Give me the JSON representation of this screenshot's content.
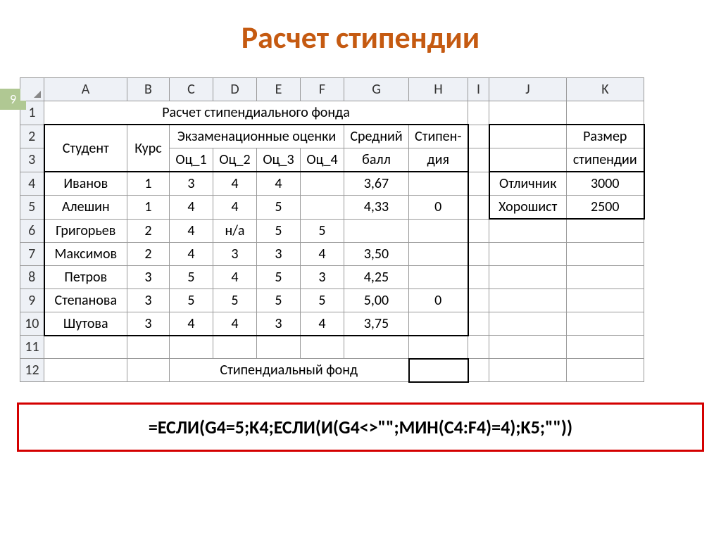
{
  "title": "Расчет стипендии",
  "page_num": "9",
  "cols": [
    "A",
    "B",
    "C",
    "D",
    "E",
    "F",
    "G",
    "H",
    "I",
    "J",
    "K"
  ],
  "row_nums": [
    "1",
    "2",
    "3",
    "4",
    "5",
    "6",
    "7",
    "8",
    "9",
    "10",
    "11",
    "12"
  ],
  "r1_title": "Расчет стипендиального фонда",
  "hdr": {
    "student": "Студент",
    "course": "Курс",
    "exam": "Экзаменационные оценки",
    "oc1": "Оц_1",
    "oc2": "Оц_2",
    "oc3": "Оц_3",
    "oc4": "Оц_4",
    "avg": "Средний",
    "avg2": "балл",
    "stip": "Стипен-",
    "stip2": "дия",
    "size1": "Размер",
    "size2": "стипендии"
  },
  "rows": [
    {
      "n": "Иванов",
      "k": "1",
      "o1": "3",
      "o2": "4",
      "o3": "4",
      "o4": "",
      "g": "3,67",
      "h": ""
    },
    {
      "n": "Алешин",
      "k": "1",
      "o1": "4",
      "o2": "4",
      "o3": "5",
      "o4": "",
      "g": "4,33",
      "h": "0"
    },
    {
      "n": "Григорьев",
      "k": "2",
      "o1": "4",
      "o2": "н/а",
      "o3": "5",
      "o4": "5",
      "g": "",
      "h": ""
    },
    {
      "n": "Максимов",
      "k": "2",
      "o1": "4",
      "o2": "3",
      "o3": "3",
      "o4": "4",
      "g": "3,50",
      "h": ""
    },
    {
      "n": "Петров",
      "k": "3",
      "o1": "5",
      "o2": "4",
      "o3": "5",
      "o4": "3",
      "g": "4,25",
      "h": ""
    },
    {
      "n": "Степанова",
      "k": "3",
      "o1": "5",
      "o2": "5",
      "o3": "5",
      "o4": "5",
      "g": "5,00",
      "h": "0"
    },
    {
      "n": "Шутова",
      "k": "3",
      "o1": "4",
      "o2": "4",
      "o3": "3",
      "o4": "4",
      "g": "3,75",
      "h": ""
    }
  ],
  "side": [
    {
      "j": "Отличник",
      "k": "3000"
    },
    {
      "j": "Хорошист",
      "k": "2500"
    }
  ],
  "footer_label": "Стипендиальный фонд",
  "formula": "=ЕСЛИ(G4=5;K4;ЕСЛИ(И(G4<>\"\";МИН(C4:F4)=4);K5;\"\"))"
}
